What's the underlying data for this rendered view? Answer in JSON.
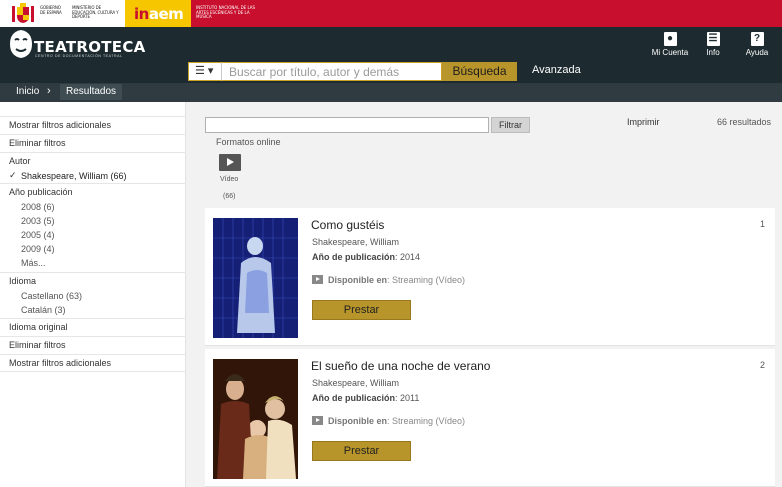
{
  "gov": {
    "ministry_text_1": "GOBIERNO DE ESPAÑA",
    "ministry_text_2": "MINISTERIO DE EDUCACIÓN, CULTURA Y DEPORTE",
    "inaem_logo_prefix": "in",
    "inaem_logo_suffix": "aem",
    "inaem_text": "INSTITUTO NACIONAL DE LAS ARTES ESCÉNICAS Y DE LA MÚSICA"
  },
  "header": {
    "brand_name": "TEATROTECA",
    "brand_sub": "CENTRO DE DOCUMENTACIÓN TEATRAL",
    "links": [
      {
        "label": "Mi Cuenta",
        "icon": "user-icon"
      },
      {
        "label": "Info",
        "icon": "menu-icon"
      },
      {
        "label": "Ayuda",
        "icon": "help-icon"
      }
    ]
  },
  "search": {
    "menu_glyph": "☰ ▾",
    "placeholder": "Buscar por título, autor y demás",
    "button_label": "Búsqueda",
    "advanced_label": "Avanzada"
  },
  "breadcrumb": {
    "home": "Inicio",
    "separator": "›",
    "current": "Resultados"
  },
  "sidebar": {
    "more_filters_top": "Mostrar filtros adicionales",
    "clear_filters_top": "Eliminar filtros",
    "author_heading": "Autor",
    "author_selected": "Shakespeare, William (66)",
    "year_heading": "Año publicación",
    "years": [
      "2008 (6)",
      "2003 (5)",
      "2005 (4)",
      "2009 (4)"
    ],
    "more_label": "Más...",
    "language_heading": "Idioma",
    "languages": [
      "Castellano (63)",
      "Catalán (3)"
    ],
    "original_language_heading": "Idioma original",
    "clear_filters_bottom": "Eliminar filtros",
    "more_filters_bottom": "Mostrar filtros adicionales"
  },
  "toolbar": {
    "filter_button": "Filtrar",
    "print_label": "Imprimir",
    "results_count": "66 resultados",
    "formats_label": "Formatos online",
    "video_label": "Vídeo",
    "video_count": "(66)"
  },
  "results": [
    {
      "number": "1",
      "title": "Como gustéis",
      "author": "Shakespeare, William",
      "year_label": "Año de publicación",
      "year": ": 2014",
      "avail_label": "Disponible en",
      "avail_value": ": Streaming (Vídeo)",
      "button": "Prestar"
    },
    {
      "number": "2",
      "title": "El sueño de una noche de verano",
      "author": "Shakespeare, William",
      "year_label": "Año de publicación",
      "year": ": 2011",
      "avail_label": "Disponible en",
      "avail_value": ": Streaming (Vídeo)",
      "button": "Prestar"
    }
  ],
  "colors": {
    "gov_red": "#c8102e",
    "gov_yellow": "#f6c700",
    "header_dark": "#1d2a2f",
    "accent_gold": "#b8952a"
  }
}
